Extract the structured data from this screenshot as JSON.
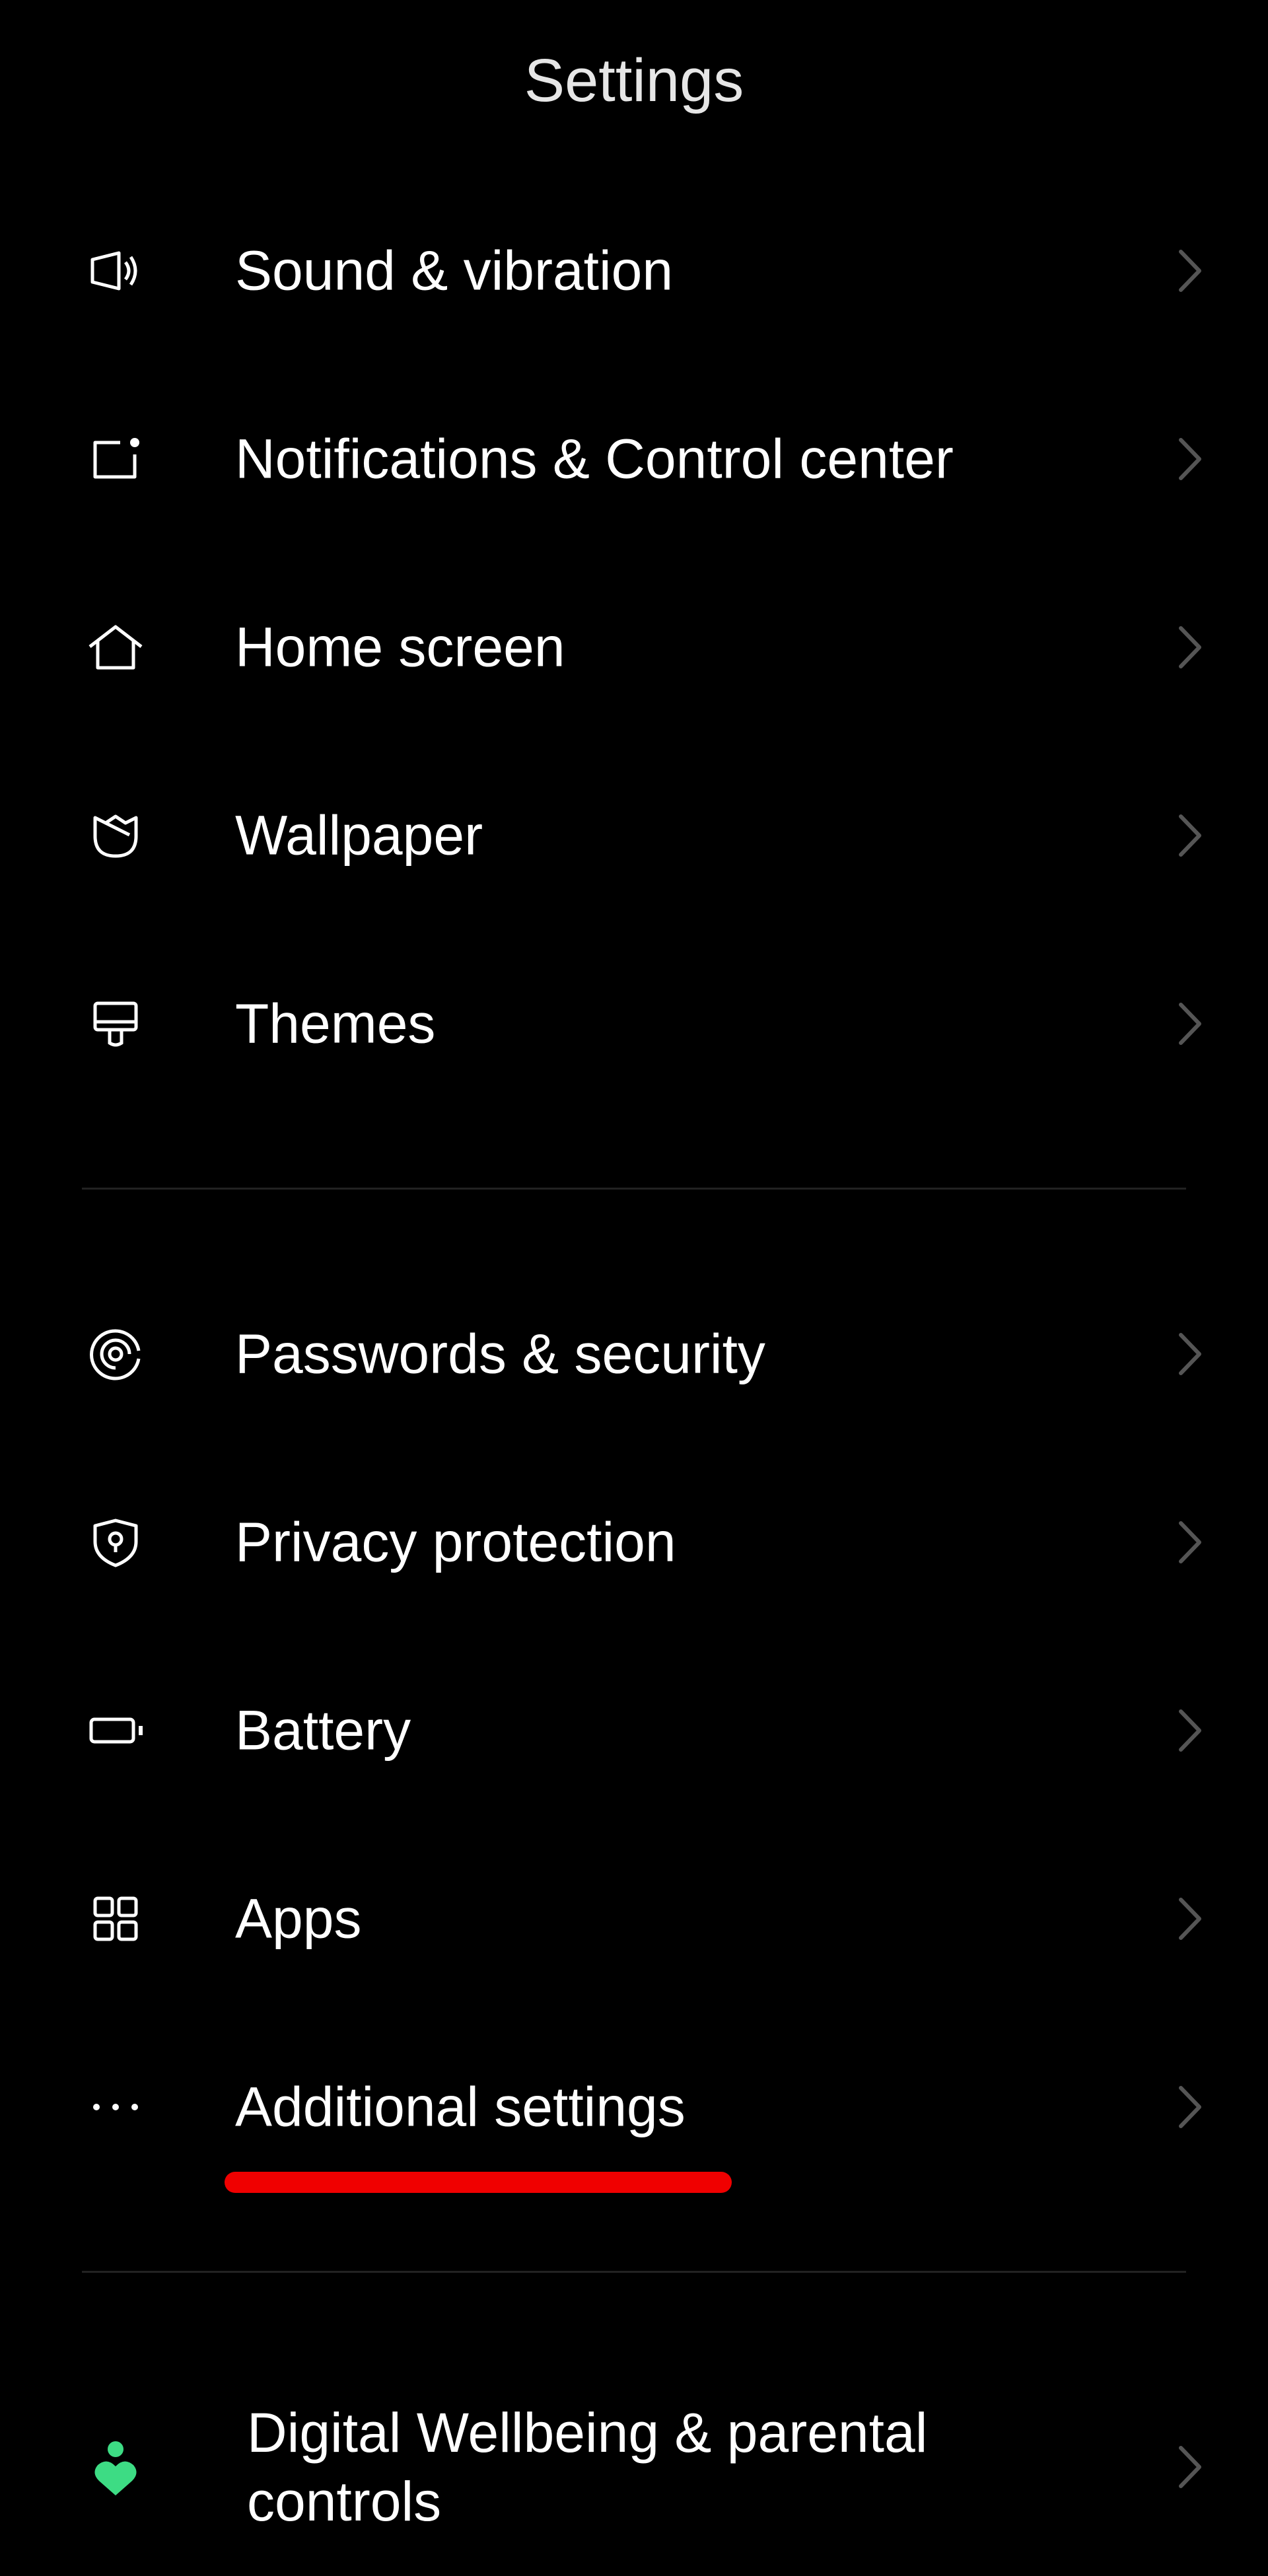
{
  "header": {
    "title": "Settings"
  },
  "groups": [
    {
      "items": [
        {
          "label": "Sound & vibration",
          "icon": "speaker-icon"
        },
        {
          "label": "Notifications & Control center",
          "icon": "notification-icon"
        },
        {
          "label": "Home screen",
          "icon": "home-icon"
        },
        {
          "label": "Wallpaper",
          "icon": "wallpaper-icon"
        },
        {
          "label": "Themes",
          "icon": "paintbrush-icon"
        }
      ]
    },
    {
      "items": [
        {
          "label": "Passwords & security",
          "icon": "fingerprint-icon"
        },
        {
          "label": "Privacy protection",
          "icon": "shield-icon"
        },
        {
          "label": "Battery",
          "icon": "battery-icon"
        },
        {
          "label": "Apps",
          "icon": "apps-grid-icon"
        },
        {
          "label": "Additional settings",
          "icon": "more-dots-icon",
          "highlighted": true
        }
      ]
    },
    {
      "items": [
        {
          "label": "Digital Wellbeing & parental controls",
          "icon": "wellbeing-icon"
        }
      ]
    }
  ],
  "colors": {
    "background": "#000000",
    "highlight_underline": "#f00000",
    "wellbeing_icon": "#3ddc84",
    "chevron": "#555555"
  }
}
